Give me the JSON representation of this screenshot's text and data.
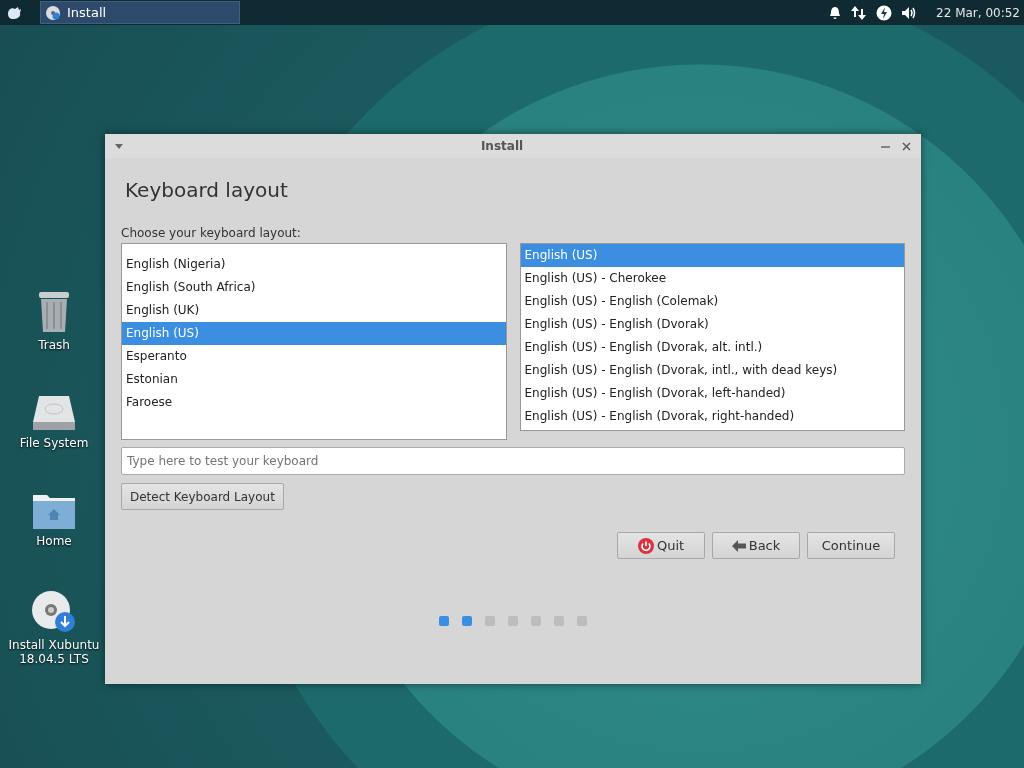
{
  "panel": {
    "task": {
      "label": "Install",
      "selected": true
    },
    "clock": "22 Mar, 00:52"
  },
  "desktop_icons": [
    {
      "kind": "trash",
      "label": "Trash"
    },
    {
      "kind": "drive",
      "label": "File System"
    },
    {
      "kind": "home",
      "label": "Home"
    },
    {
      "kind": "installer",
      "label": "Install Xubuntu 18.04.5 LTS"
    }
  ],
  "window": {
    "title": "Install",
    "heading": "Keyboard layout",
    "prompt": "Choose your keyboard layout:",
    "layouts": [
      {
        "label": "English (Nigeria)",
        "selected": false
      },
      {
        "label": "English (South Africa)",
        "selected": false
      },
      {
        "label": "English (UK)",
        "selected": false
      },
      {
        "label": "English (US)",
        "selected": true
      },
      {
        "label": "Esperanto",
        "selected": false
      },
      {
        "label": "Estonian",
        "selected": false
      },
      {
        "label": "Faroese",
        "selected": false
      }
    ],
    "variants": [
      {
        "label": "English (US)",
        "selected": true
      },
      {
        "label": "English (US) - Cherokee",
        "selected": false
      },
      {
        "label": "English (US) - English (Colemak)",
        "selected": false
      },
      {
        "label": "English (US) - English (Dvorak)",
        "selected": false
      },
      {
        "label": "English (US) - English (Dvorak, alt. intl.)",
        "selected": false
      },
      {
        "label": "English (US) - English (Dvorak, intl., with dead keys)",
        "selected": false
      },
      {
        "label": "English (US) - English (Dvorak, left-handed)",
        "selected": false
      },
      {
        "label": "English (US) - English (Dvorak, right-handed)",
        "selected": false
      }
    ],
    "test_field": {
      "placeholder": "Type here to test your keyboard"
    },
    "detect_button": "Detect Keyboard Layout",
    "buttons": [
      {
        "kind": "quit",
        "label": "Quit"
      },
      {
        "kind": "back",
        "label": "Back"
      },
      {
        "kind": "continue",
        "label": "Continue"
      }
    ],
    "steps": [
      {
        "done": true
      },
      {
        "done": true
      },
      {
        "done": false
      },
      {
        "done": false
      },
      {
        "done": false
      },
      {
        "done": false
      },
      {
        "done": false
      }
    ]
  }
}
